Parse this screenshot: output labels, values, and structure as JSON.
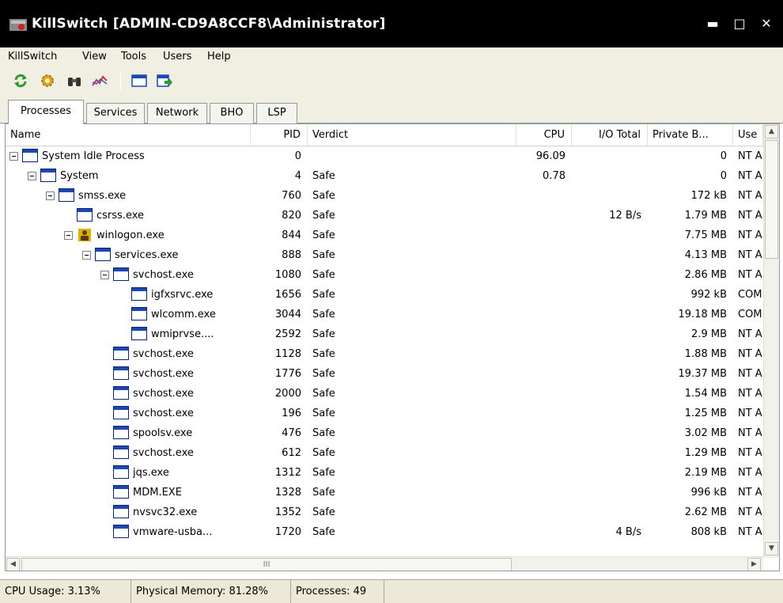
{
  "window": {
    "title": "KillSwitch [ADMIN-CD9A8CCF8\\Administrator]",
    "minimize_glyph": "▬",
    "maximize_glyph": "□",
    "close_glyph": "✕"
  },
  "menu": [
    "KillSwitch",
    "View",
    "Tools",
    "Users",
    "Help"
  ],
  "toolbar_icons": [
    "refresh-icon",
    "settings-gear-icon",
    "binoculars-find-icon",
    "chart-icon",
    "window-icon",
    "export-icon"
  ],
  "tabs": [
    "Processes",
    "Services",
    "Network",
    "BHO",
    "LSP"
  ],
  "active_tab": "Processes",
  "columns": [
    "Name",
    "PID",
    "Verdict",
    "CPU",
    "I/O Total",
    "Private B...",
    "Use"
  ],
  "processes": [
    {
      "name": "System Idle Process",
      "pid": "0",
      "verdict": "",
      "cpu": "96.09",
      "io": "",
      "private": "0",
      "user": "NT A"
    },
    {
      "name": "System",
      "pid": "4",
      "verdict": "Safe",
      "cpu": "0.78",
      "io": "",
      "private": "0",
      "user": "NT A"
    },
    {
      "name": "smss.exe",
      "pid": "760",
      "verdict": "Safe",
      "cpu": "",
      "io": "",
      "private": "172 kB",
      "user": "NT A"
    },
    {
      "name": "csrss.exe",
      "pid": "820",
      "verdict": "Safe",
      "cpu": "",
      "io": "12 B/s",
      "private": "1.79 MB",
      "user": "NT A"
    },
    {
      "name": "winlogon.exe",
      "pid": "844",
      "verdict": "Safe",
      "cpu": "",
      "io": "",
      "private": "7.75 MB",
      "user": "NT A"
    },
    {
      "name": "services.exe",
      "pid": "888",
      "verdict": "Safe",
      "cpu": "",
      "io": "",
      "private": "4.13 MB",
      "user": "NT A"
    },
    {
      "name": "svchost.exe",
      "pid": "1080",
      "verdict": "Safe",
      "cpu": "",
      "io": "",
      "private": "2.86 MB",
      "user": "NT A"
    },
    {
      "name": "igfxsrvc.exe",
      "pid": "1656",
      "verdict": "Safe",
      "cpu": "",
      "io": "",
      "private": "992 kB",
      "user": "COM"
    },
    {
      "name": "wlcomm.exe",
      "pid": "3044",
      "verdict": "Safe",
      "cpu": "",
      "io": "",
      "private": "19.18 MB",
      "user": "COM"
    },
    {
      "name": "wmiprvse....",
      "pid": "2592",
      "verdict": "Safe",
      "cpu": "",
      "io": "",
      "private": "2.9 MB",
      "user": "NT A"
    },
    {
      "name": "svchost.exe",
      "pid": "1128",
      "verdict": "Safe",
      "cpu": "",
      "io": "",
      "private": "1.88 MB",
      "user": "NT A"
    },
    {
      "name": "svchost.exe",
      "pid": "1776",
      "verdict": "Safe",
      "cpu": "",
      "io": "",
      "private": "19.37 MB",
      "user": "NT A"
    },
    {
      "name": "svchost.exe",
      "pid": "2000",
      "verdict": "Safe",
      "cpu": "",
      "io": "",
      "private": "1.54 MB",
      "user": "NT A"
    },
    {
      "name": "svchost.exe",
      "pid": "196",
      "verdict": "Safe",
      "cpu": "",
      "io": "",
      "private": "1.25 MB",
      "user": "NT A"
    },
    {
      "name": "spoolsv.exe",
      "pid": "476",
      "verdict": "Safe",
      "cpu": "",
      "io": "",
      "private": "3.02 MB",
      "user": "NT A"
    },
    {
      "name": "svchost.exe",
      "pid": "612",
      "verdict": "Safe",
      "cpu": "",
      "io": "",
      "private": "1.29 MB",
      "user": "NT A"
    },
    {
      "name": "jqs.exe",
      "pid": "1312",
      "verdict": "Safe",
      "cpu": "",
      "io": "",
      "private": "2.19 MB",
      "user": "NT A"
    },
    {
      "name": "MDM.EXE",
      "pid": "1328",
      "verdict": "Safe",
      "cpu": "",
      "io": "",
      "private": "996 kB",
      "user": "NT A"
    },
    {
      "name": "nvsvc32.exe",
      "pid": "1352",
      "verdict": "Safe",
      "cpu": "",
      "io": "",
      "private": "2.62 MB",
      "user": "NT A"
    },
    {
      "name": "vmware-usba...",
      "pid": "1720",
      "verdict": "Safe",
      "cpu": "",
      "io": "4 B/s",
      "private": "808 kB",
      "user": "NT A"
    }
  ],
  "scroll": {
    "vertical_fraction": 0.02,
    "horizontal_fraction": 0.0,
    "grip": "III"
  },
  "status": {
    "cpu": "CPU Usage: 3.13%",
    "memory": "Physical Memory: 81.28%",
    "processes": "Processes: 49"
  },
  "colors": {
    "title_bg": "#000000",
    "chrome_bg": "#f1efe2",
    "icon_blue": "#1c47b4"
  }
}
